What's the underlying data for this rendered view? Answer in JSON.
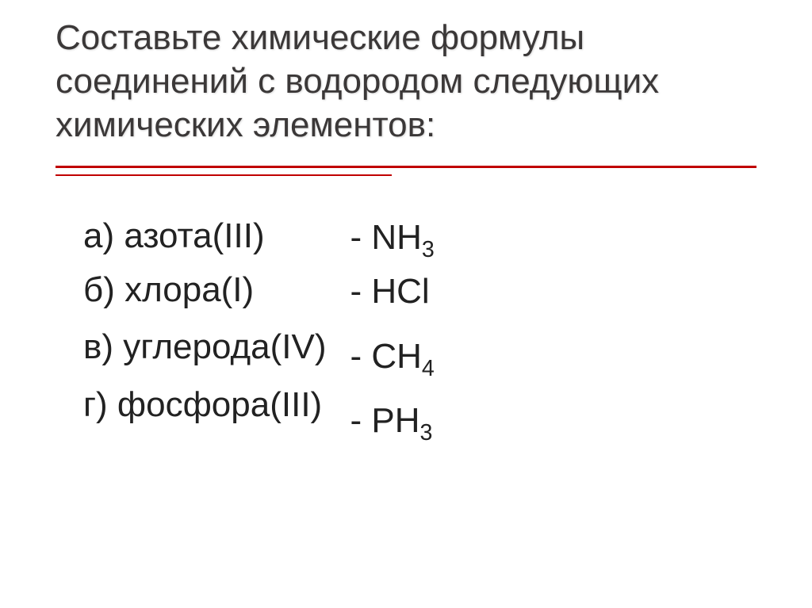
{
  "title": "Составьте химические формулы соединений с водородом следующих химических элементов:",
  "items": [
    {
      "label": "а) азота(III)",
      "answer_prefix": "- NH",
      "answer_sub": "3"
    },
    {
      "label": "б) хлора(I)",
      "answer_prefix": "- HCl",
      "answer_sub": ""
    },
    {
      "label": "в) углерода(IV)",
      "answer_prefix": "- CH",
      "answer_sub": "4"
    },
    {
      "label": "г) фосфора(III)",
      "answer_prefix": "- PH",
      "answer_sub": "3"
    }
  ]
}
